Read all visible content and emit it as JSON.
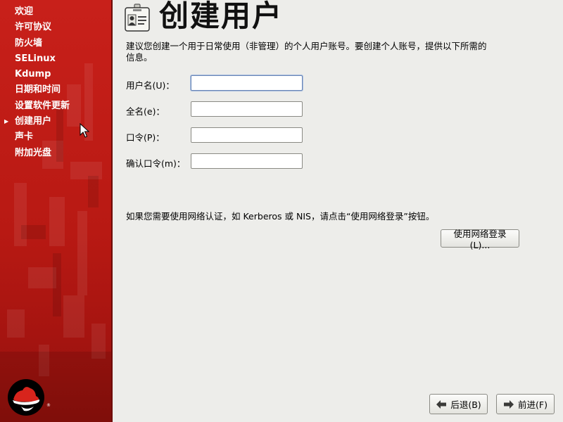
{
  "sidebar": {
    "items": [
      {
        "label": "欢迎"
      },
      {
        "label": "许可协议"
      },
      {
        "label": "防火墙"
      },
      {
        "label": "SELinux"
      },
      {
        "label": "Kdump"
      },
      {
        "label": "日期和时间"
      },
      {
        "label": "设置软件更新"
      },
      {
        "label": "创建用户"
      },
      {
        "label": "声卡"
      },
      {
        "label": "附加光盘"
      }
    ],
    "current_index": 7
  },
  "header": {
    "title": "创建用户",
    "icon": "user-card-icon"
  },
  "intro_text": "建议您创建一个用于日常使用（非管理）的个人用户账号。要创建个人账号，提供以下所需的信息。",
  "form": {
    "username_label": "用户名(U)：",
    "fullname_label": "全名(e)：",
    "password_label": "口令(P)：",
    "confirm_label": "确认口令(m)：",
    "username_value": "",
    "fullname_value": "",
    "password_value": "",
    "confirm_value": ""
  },
  "network_note": "如果您需要使用网络认证，如 Kerberos 或 NIS，请点击“使用网络登录”按钮。",
  "buttons": {
    "network_login": "使用网络登录(L)...",
    "back": "后退(B)",
    "next": "前进(F)"
  },
  "colors": {
    "sidebar_red": "#c8201a",
    "background": "#ededea"
  }
}
